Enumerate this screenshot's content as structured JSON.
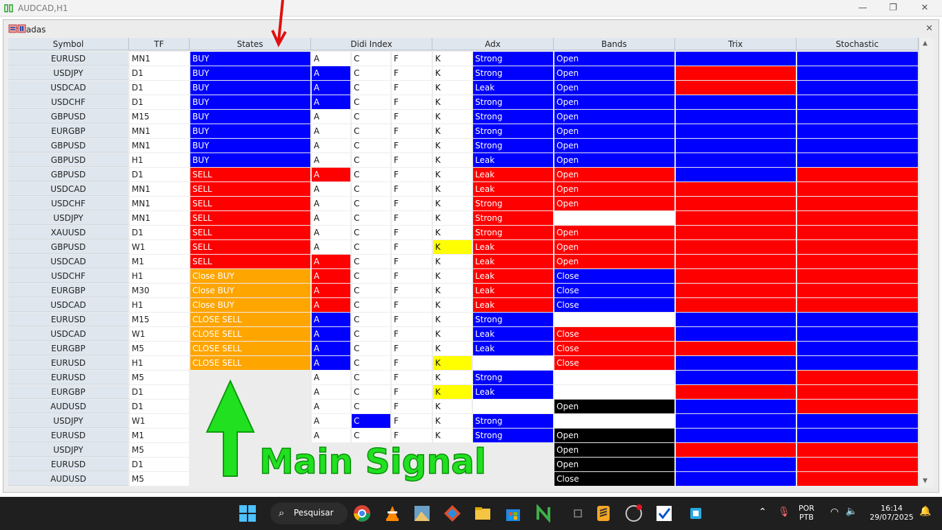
{
  "window": {
    "title": "AUDCAD,H1",
    "minimize": "—",
    "restore": "❐",
    "close": "✕"
  },
  "panel": {
    "title": "Entradas",
    "close": "✕"
  },
  "colors": {
    "blue": "#0000ff",
    "red": "#ff0000",
    "orange": "#ffa500",
    "yellow": "#ffff00",
    "black": "#000000",
    "white": "#ffffff",
    "green_text": "#20e020"
  },
  "columns": [
    "Symbol",
    "TF",
    "States",
    "Didi Index",
    "Adx",
    "Bands",
    "Trix",
    "Stochastic"
  ],
  "rows": [
    {
      "symbol": "EURUSD",
      "tf": "MN1",
      "state": "BUY",
      "state_c": "blue",
      "a": "A",
      "a_c": "white",
      "c": "C",
      "c_c": "white",
      "f": "F",
      "k": "K",
      "k_c": "white",
      "adx": "Strong",
      "adx_c": "blue",
      "bands": "Open",
      "bands_c": "blue",
      "trix_c": "blue",
      "stoch_c": "blue"
    },
    {
      "symbol": "USDJPY",
      "tf": "D1",
      "state": "BUY",
      "state_c": "blue",
      "a": "A",
      "a_c": "blue",
      "c": "C",
      "c_c": "white",
      "f": "F",
      "k": "K",
      "k_c": "white",
      "adx": "Strong",
      "adx_c": "blue",
      "bands": "Open",
      "bands_c": "blue",
      "trix_c": "red",
      "stoch_c": "blue"
    },
    {
      "symbol": "USDCAD",
      "tf": "D1",
      "state": "BUY",
      "state_c": "blue",
      "a": "A",
      "a_c": "blue",
      "c": "C",
      "c_c": "white",
      "f": "F",
      "k": "K",
      "k_c": "white",
      "adx": "Leak",
      "adx_c": "blue",
      "bands": "Open",
      "bands_c": "blue",
      "trix_c": "red",
      "stoch_c": "blue"
    },
    {
      "symbol": "USDCHF",
      "tf": "D1",
      "state": "BUY",
      "state_c": "blue",
      "a": "A",
      "a_c": "blue",
      "c": "C",
      "c_c": "white",
      "f": "F",
      "k": "K",
      "k_c": "white",
      "adx": "Strong",
      "adx_c": "blue",
      "bands": "Open",
      "bands_c": "blue",
      "trix_c": "blue",
      "stoch_c": "blue"
    },
    {
      "symbol": "GBPUSD",
      "tf": "M15",
      "state": "BUY",
      "state_c": "blue",
      "a": "A",
      "a_c": "white",
      "c": "C",
      "c_c": "white",
      "f": "F",
      "k": "K",
      "k_c": "white",
      "adx": "Strong",
      "adx_c": "blue",
      "bands": "Open",
      "bands_c": "blue",
      "trix_c": "blue",
      "stoch_c": "blue"
    },
    {
      "symbol": "EURGBP",
      "tf": "MN1",
      "state": "BUY",
      "state_c": "blue",
      "a": "A",
      "a_c": "white",
      "c": "C",
      "c_c": "white",
      "f": "F",
      "k": "K",
      "k_c": "white",
      "adx": "Strong",
      "adx_c": "blue",
      "bands": "Open",
      "bands_c": "blue",
      "trix_c": "blue",
      "stoch_c": "blue"
    },
    {
      "symbol": "GBPUSD",
      "tf": "MN1",
      "state": "BUY",
      "state_c": "blue",
      "a": "A",
      "a_c": "white",
      "c": "C",
      "c_c": "white",
      "f": "F",
      "k": "K",
      "k_c": "white",
      "adx": "Strong",
      "adx_c": "blue",
      "bands": "Open",
      "bands_c": "blue",
      "trix_c": "blue",
      "stoch_c": "blue"
    },
    {
      "symbol": "GBPUSD",
      "tf": "H1",
      "state": "BUY",
      "state_c": "blue",
      "a": "A",
      "a_c": "white",
      "c": "C",
      "c_c": "white",
      "f": "F",
      "k": "K",
      "k_c": "white",
      "adx": "Leak",
      "adx_c": "blue",
      "bands": "Open",
      "bands_c": "blue",
      "trix_c": "blue",
      "stoch_c": "blue"
    },
    {
      "symbol": "GBPUSD",
      "tf": "D1",
      "state": "SELL",
      "state_c": "red",
      "a": "A",
      "a_c": "red",
      "c": "C",
      "c_c": "white",
      "f": "F",
      "k": "K",
      "k_c": "white",
      "adx": "Leak",
      "adx_c": "red",
      "bands": "Open",
      "bands_c": "red",
      "trix_c": "blue",
      "stoch_c": "red"
    },
    {
      "symbol": "USDCAD",
      "tf": "MN1",
      "state": "SELL",
      "state_c": "red",
      "a": "A",
      "a_c": "white",
      "c": "C",
      "c_c": "white",
      "f": "F",
      "k": "K",
      "k_c": "white",
      "adx": "Leak",
      "adx_c": "red",
      "bands": "Open",
      "bands_c": "red",
      "trix_c": "red",
      "stoch_c": "red"
    },
    {
      "symbol": "USDCHF",
      "tf": "MN1",
      "state": "SELL",
      "state_c": "red",
      "a": "A",
      "a_c": "white",
      "c": "C",
      "c_c": "white",
      "f": "F",
      "k": "K",
      "k_c": "white",
      "adx": "Strong",
      "adx_c": "red",
      "bands": "Open",
      "bands_c": "red",
      "trix_c": "red",
      "stoch_c": "red"
    },
    {
      "symbol": "USDJPY",
      "tf": "MN1",
      "state": "SELL",
      "state_c": "red",
      "a": "A",
      "a_c": "white",
      "c": "C",
      "c_c": "white",
      "f": "F",
      "k": "K",
      "k_c": "white",
      "adx": "Strong",
      "adx_c": "red",
      "bands": "",
      "bands_c": "white",
      "trix_c": "red",
      "stoch_c": "red"
    },
    {
      "symbol": "XAUUSD",
      "tf": "D1",
      "state": "SELL",
      "state_c": "red",
      "a": "A",
      "a_c": "white",
      "c": "C",
      "c_c": "white",
      "f": "F",
      "k": "K",
      "k_c": "white",
      "adx": "Strong",
      "adx_c": "red",
      "bands": "Open",
      "bands_c": "red",
      "trix_c": "red",
      "stoch_c": "red"
    },
    {
      "symbol": "GBPUSD",
      "tf": "W1",
      "state": "SELL",
      "state_c": "red",
      "a": "A",
      "a_c": "white",
      "c": "C",
      "c_c": "white",
      "f": "F",
      "k": "K",
      "k_c": "yellow",
      "adx": "Leak",
      "adx_c": "red",
      "bands": "Open",
      "bands_c": "red",
      "trix_c": "red",
      "stoch_c": "red"
    },
    {
      "symbol": "USDCAD",
      "tf": "M1",
      "state": "SELL",
      "state_c": "red",
      "a": "A",
      "a_c": "red",
      "c": "C",
      "c_c": "white",
      "f": "F",
      "k": "K",
      "k_c": "white",
      "adx": "Leak",
      "adx_c": "red",
      "bands": "Open",
      "bands_c": "red",
      "trix_c": "red",
      "stoch_c": "red"
    },
    {
      "symbol": "USDCHF",
      "tf": "H1",
      "state": "Close BUY",
      "state_c": "orange",
      "a": "A",
      "a_c": "red",
      "c": "C",
      "c_c": "white",
      "f": "F",
      "k": "K",
      "k_c": "white",
      "adx": "Leak",
      "adx_c": "red",
      "bands": "Close",
      "bands_c": "blue",
      "trix_c": "red",
      "stoch_c": "red"
    },
    {
      "symbol": "EURGBP",
      "tf": "M30",
      "state": "Close BUY",
      "state_c": "orange",
      "a": "A",
      "a_c": "red",
      "c": "C",
      "c_c": "white",
      "f": "F",
      "k": "K",
      "k_c": "white",
      "adx": "Leak",
      "adx_c": "red",
      "bands": "Close",
      "bands_c": "blue",
      "trix_c": "red",
      "stoch_c": "red"
    },
    {
      "symbol": "USDCAD",
      "tf": "H1",
      "state": "Close BUY",
      "state_c": "orange",
      "a": "A",
      "a_c": "red",
      "c": "C",
      "c_c": "white",
      "f": "F",
      "k": "K",
      "k_c": "white",
      "adx": "Leak",
      "adx_c": "red",
      "bands": "Close",
      "bands_c": "blue",
      "trix_c": "red",
      "stoch_c": "red"
    },
    {
      "symbol": "EURUSD",
      "tf": "M15",
      "state": "CLOSE SELL",
      "state_c": "orange",
      "a": "A",
      "a_c": "blue",
      "c": "C",
      "c_c": "white",
      "f": "F",
      "k": "K",
      "k_c": "white",
      "adx": "Strong",
      "adx_c": "blue",
      "bands": "",
      "bands_c": "white",
      "trix_c": "blue",
      "stoch_c": "blue"
    },
    {
      "symbol": "USDCAD",
      "tf": "W1",
      "state": "CLOSE SELL",
      "state_c": "orange",
      "a": "A",
      "a_c": "blue",
      "c": "C",
      "c_c": "white",
      "f": "F",
      "k": "K",
      "k_c": "white",
      "adx": "Leak",
      "adx_c": "blue",
      "bands": "Close",
      "bands_c": "red",
      "trix_c": "blue",
      "stoch_c": "blue"
    },
    {
      "symbol": "EURGBP",
      "tf": "M5",
      "state": "CLOSE SELL",
      "state_c": "orange",
      "a": "A",
      "a_c": "blue",
      "c": "C",
      "c_c": "white",
      "f": "F",
      "k": "K",
      "k_c": "white",
      "adx": "Leak",
      "adx_c": "blue",
      "bands": "Close",
      "bands_c": "red",
      "trix_c": "red",
      "stoch_c": "blue"
    },
    {
      "symbol": "EURUSD",
      "tf": "H1",
      "state": "CLOSE SELL",
      "state_c": "orange",
      "a": "A",
      "a_c": "blue",
      "c": "C",
      "c_c": "white",
      "f": "F",
      "k": "K",
      "k_c": "yellow",
      "adx": "",
      "adx_c": "white",
      "bands": "Close",
      "bands_c": "red",
      "trix_c": "blue",
      "stoch_c": "blue"
    },
    {
      "symbol": "EURUSD",
      "tf": "M5",
      "state": "",
      "state_c": "white",
      "a": "A",
      "a_c": "white",
      "c": "C",
      "c_c": "white",
      "f": "F",
      "k": "K",
      "k_c": "white",
      "adx": "Strong",
      "adx_c": "blue",
      "bands": "",
      "bands_c": "white",
      "trix_c": "blue",
      "stoch_c": "red"
    },
    {
      "symbol": "EURGBP",
      "tf": "D1",
      "state": "",
      "state_c": "white",
      "a": "A",
      "a_c": "white",
      "c": "C",
      "c_c": "white",
      "f": "F",
      "k": "K",
      "k_c": "yellow",
      "adx": "Leak",
      "adx_c": "blue",
      "bands": "",
      "bands_c": "white",
      "trix_c": "red",
      "stoch_c": "red"
    },
    {
      "symbol": "AUDUSD",
      "tf": "D1",
      "state": "",
      "state_c": "white",
      "a": "A",
      "a_c": "white",
      "c": "C",
      "c_c": "white",
      "f": "F",
      "k": "K",
      "k_c": "white",
      "adx": "",
      "adx_c": "white",
      "bands": "Open",
      "bands_c": "black",
      "trix_c": "blue",
      "stoch_c": "red"
    },
    {
      "symbol": "USDJPY",
      "tf": "W1",
      "state": "",
      "state_c": "white",
      "a": "A",
      "a_c": "white",
      "c": "C",
      "c_c": "blue",
      "f": "F",
      "k": "K",
      "k_c": "white",
      "adx": "Strong",
      "adx_c": "blue",
      "bands": "",
      "bands_c": "white",
      "trix_c": "blue",
      "stoch_c": "blue"
    },
    {
      "symbol": "EURUSD",
      "tf": "M1",
      "state": "",
      "state_c": "white",
      "a": "A",
      "a_c": "white",
      "c": "C",
      "c_c": "white",
      "f": "F",
      "k": "K",
      "k_c": "white",
      "adx": "Strong",
      "adx_c": "blue",
      "bands": "Open",
      "bands_c": "black",
      "trix_c": "blue",
      "stoch_c": "blue"
    },
    {
      "symbol": "USDJPY",
      "tf": "M5",
      "state": "",
      "state_c": "white",
      "a": "",
      "a_c": "white",
      "c": "",
      "c_c": "white",
      "f": "",
      "k": "",
      "k_c": "white",
      "adx": "",
      "adx_c": "white",
      "bands": "Open",
      "bands_c": "black",
      "trix_c": "red",
      "stoch_c": "red"
    },
    {
      "symbol": "EURUSD",
      "tf": "D1",
      "state": "",
      "state_c": "white",
      "a": "",
      "a_c": "white",
      "c": "",
      "c_c": "white",
      "f": "",
      "k": "",
      "k_c": "white",
      "adx": "",
      "adx_c": "white",
      "bands": "Open",
      "bands_c": "black",
      "trix_c": "blue",
      "stoch_c": "red"
    },
    {
      "symbol": "AUDUSD",
      "tf": "M5",
      "state": "",
      "state_c": "white",
      "a": "",
      "a_c": "white",
      "c": "",
      "c_c": "white",
      "f": "",
      "k": "",
      "k_c": "white",
      "adx": "",
      "adx_c": "white",
      "bands": "Close",
      "bands_c": "black",
      "trix_c": "blue",
      "stoch_c": "red"
    }
  ],
  "annotation": {
    "text": "Main Signal"
  },
  "taskbar": {
    "search_label": "Pesquisar",
    "language": "POR",
    "layout": "PTB",
    "time": "16:14",
    "date": "29/07/2025",
    "icons": [
      "windows-start-icon",
      "chrome-icon",
      "vlc-icon",
      "paint-icon",
      "git-icon",
      "file-explorer-icon",
      "store-icon",
      "nodejs-icon",
      "app-icon",
      "sublime-icon",
      "obs-icon",
      "vscode-check-icon",
      "app-square-icon"
    ]
  }
}
